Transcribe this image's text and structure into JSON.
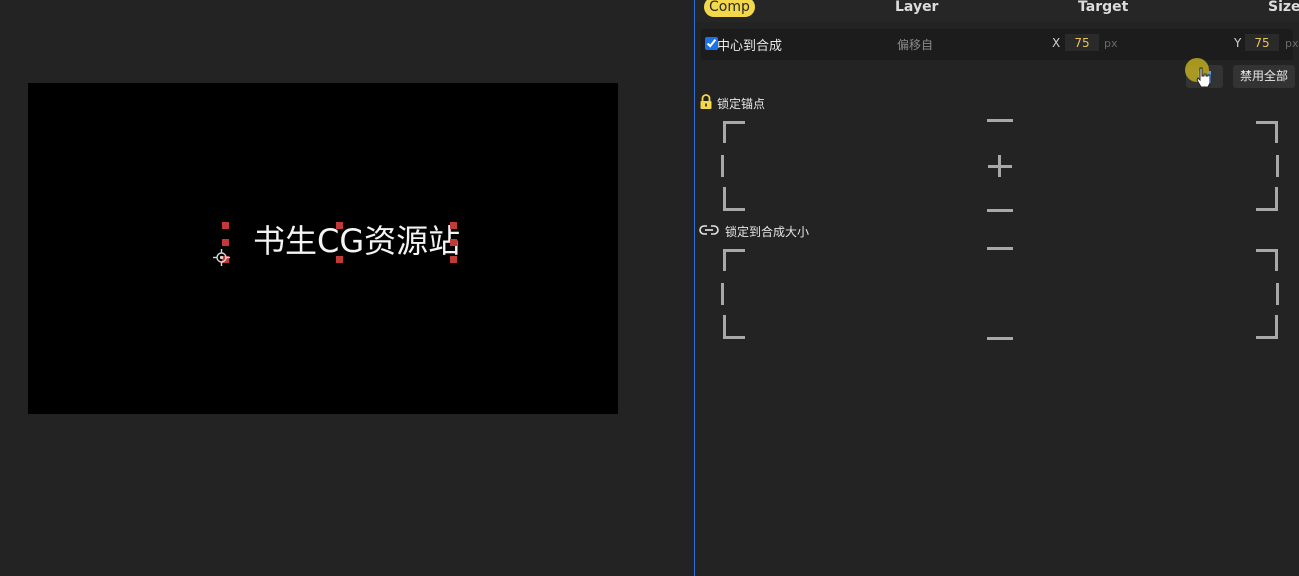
{
  "viewer": {
    "text_layer": "书生CG资源站"
  },
  "panel": {
    "tabs": [
      {
        "label": "Comp",
        "active": true
      },
      {
        "label": "Layer"
      },
      {
        "label": "Target"
      },
      {
        "label": "Size"
      }
    ],
    "center_row": {
      "checkbox_checked": true,
      "label": "中心到合成",
      "offset_label": "偏移自",
      "x_label": "X",
      "x_value": "75",
      "y_label": "Y",
      "y_value": "75",
      "unit": "px"
    },
    "buttons": {
      "enable_all": "禁用全部"
    },
    "lock_anchor": {
      "label": "锁定锚点",
      "icon": "lock-icon"
    },
    "lock_size": {
      "label": "锁定到合成大小",
      "icon": "link-icon"
    }
  },
  "colors": {
    "accent_tab": "#f2d84a",
    "divider": "#2d6fd6",
    "value_text": "#e8c454",
    "handle": "#c03a3a"
  }
}
